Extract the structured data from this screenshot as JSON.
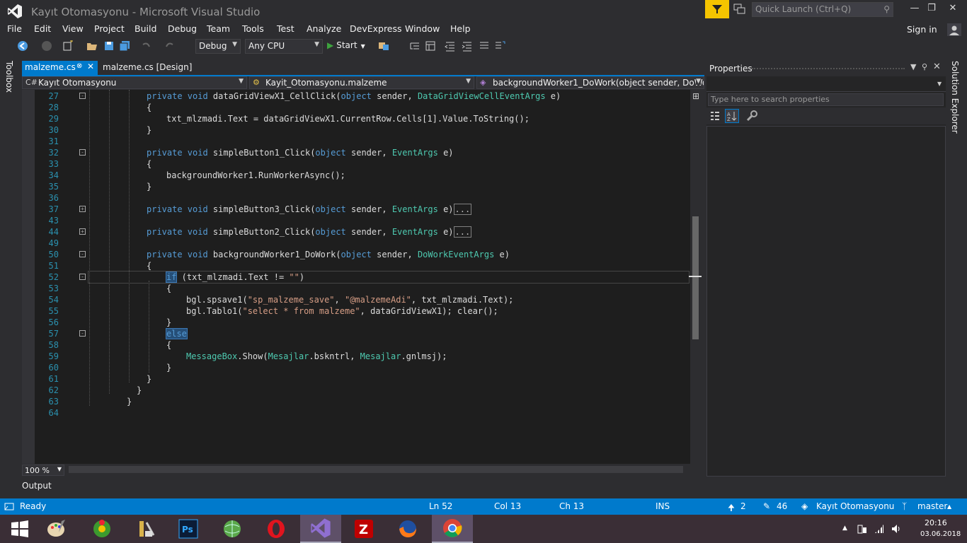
{
  "window": {
    "title": "Kayıt Otomasyonu - Microsoft Visual Studio",
    "quick_launch_placeholder": "Quick Launch (Ctrl+Q)",
    "sign_in": "Sign in"
  },
  "menu": [
    "File",
    "Edit",
    "View",
    "Project",
    "Build",
    "Debug",
    "Team",
    "Tools",
    "Test",
    "Analyze",
    "DevExpress",
    "Window",
    "Help"
  ],
  "toolbar": {
    "config": "Debug",
    "platform": "Any CPU",
    "start": "Start"
  },
  "side": {
    "toolbox": "Toolbox",
    "solution_explorer": "Solution Explorer"
  },
  "tabs": {
    "active": "malzeme.cs",
    "design": "malzeme.cs [Design]"
  },
  "nav": {
    "project": "Kayıt Otomasyonu",
    "class": "Kayit_Otomasyonu.malzeme",
    "member": "backgroundWorker1_DoWork(object sender, DoWork"
  },
  "code_lines": [
    {
      "n": "27",
      "fold": "-",
      "indent": 1,
      "tokens": [
        [
          "kw",
          "private void "
        ],
        [
          "",
          "dataGridViewX1_CellClick("
        ],
        [
          "kw",
          "object"
        ],
        [
          "",
          " sender, "
        ],
        [
          "ty",
          "DataGridViewCellEventArgs"
        ],
        [
          "",
          " e)"
        ]
      ]
    },
    {
      "n": "28",
      "fold": "",
      "indent": 1,
      "tokens": [
        [
          "",
          "{"
        ]
      ]
    },
    {
      "n": "29",
      "fold": "",
      "indent": 2,
      "tokens": [
        [
          "",
          "txt_mlzmadi.Text = dataGridViewX1.CurrentRow.Cells[1].Value.ToString();"
        ]
      ]
    },
    {
      "n": "30",
      "fold": "",
      "indent": 1,
      "tokens": [
        [
          "",
          "}"
        ]
      ]
    },
    {
      "n": "31",
      "fold": "",
      "indent": 0,
      "tokens": []
    },
    {
      "n": "32",
      "fold": "-",
      "indent": 1,
      "tokens": [
        [
          "kw",
          "private void "
        ],
        [
          "",
          "simpleButton1_Click("
        ],
        [
          "kw",
          "object"
        ],
        [
          "",
          " sender, "
        ],
        [
          "ty",
          "EventArgs"
        ],
        [
          "",
          " e)"
        ]
      ]
    },
    {
      "n": "33",
      "fold": "",
      "indent": 1,
      "tokens": [
        [
          "",
          "{"
        ]
      ]
    },
    {
      "n": "34",
      "fold": "",
      "indent": 2,
      "tokens": [
        [
          "",
          "backgroundWorker1.RunWorkerAsync();"
        ]
      ]
    },
    {
      "n": "35",
      "fold": "",
      "indent": 1,
      "tokens": [
        [
          "",
          "}"
        ]
      ]
    },
    {
      "n": "36",
      "fold": "",
      "indent": 0,
      "tokens": []
    },
    {
      "n": "37",
      "fold": "+",
      "indent": 1,
      "tokens": [
        [
          "kw",
          "private void "
        ],
        [
          "",
          "simpleButton3_Click("
        ],
        [
          "kw",
          "object"
        ],
        [
          "",
          " sender, "
        ],
        [
          "ty",
          "EventArgs"
        ],
        [
          "",
          " e)"
        ],
        [
          "collapsed",
          "..."
        ]
      ]
    },
    {
      "n": "43",
      "fold": "",
      "indent": 0,
      "tokens": []
    },
    {
      "n": "44",
      "fold": "+",
      "indent": 1,
      "tokens": [
        [
          "kw",
          "private void "
        ],
        [
          "",
          "simpleButton2_Click("
        ],
        [
          "kw",
          "object"
        ],
        [
          "",
          " sender, "
        ],
        [
          "ty",
          "EventArgs"
        ],
        [
          "",
          " e)"
        ],
        [
          "collapsed",
          "..."
        ]
      ]
    },
    {
      "n": "49",
      "fold": "",
      "indent": 0,
      "tokens": []
    },
    {
      "n": "50",
      "fold": "-",
      "indent": 1,
      "tokens": [
        [
          "kw",
          "private void "
        ],
        [
          "",
          "backgroundWorker1_DoWork("
        ],
        [
          "kw",
          "object"
        ],
        [
          "",
          " sender, "
        ],
        [
          "ty",
          "DoWorkEventArgs"
        ],
        [
          "",
          " e)"
        ]
      ]
    },
    {
      "n": "51",
      "fold": "",
      "indent": 1,
      "tokens": [
        [
          "",
          "{"
        ]
      ]
    },
    {
      "n": "52",
      "fold": "-",
      "indent": 2,
      "tokens": [
        [
          "hl-kw",
          "if"
        ],
        [
          "",
          " (txt_mlzmadi.Text != "
        ],
        [
          "st",
          "\"\""
        ],
        [
          "",
          ")"
        ]
      ]
    },
    {
      "n": "53",
      "fold": "",
      "indent": 2,
      "tokens": [
        [
          "",
          "{"
        ]
      ]
    },
    {
      "n": "54",
      "fold": "",
      "indent": 3,
      "tokens": [
        [
          "",
          "bgl.spsave1("
        ],
        [
          "st",
          "\"sp_malzeme_save\""
        ],
        [
          "",
          ", "
        ],
        [
          "st",
          "\"@malzemeAdi\""
        ],
        [
          "",
          ", txt_mlzmadi.Text);"
        ]
      ]
    },
    {
      "n": "55",
      "fold": "",
      "indent": 3,
      "tokens": [
        [
          "",
          "bgl.Tablo1("
        ],
        [
          "st",
          "\"select * from malzeme\""
        ],
        [
          "",
          ", dataGridViewX1); clear();"
        ]
      ]
    },
    {
      "n": "56",
      "fold": "",
      "indent": 2,
      "tokens": [
        [
          "",
          "}"
        ]
      ]
    },
    {
      "n": "57",
      "fold": "-",
      "indent": 2,
      "tokens": [
        [
          "hl-kw",
          "else"
        ]
      ]
    },
    {
      "n": "58",
      "fold": "",
      "indent": 2,
      "tokens": [
        [
          "",
          "{"
        ]
      ]
    },
    {
      "n": "59",
      "fold": "",
      "indent": 3,
      "tokens": [
        [
          "ty",
          "MessageBox"
        ],
        [
          "",
          ".Show("
        ],
        [
          "ty",
          "Mesajlar"
        ],
        [
          "",
          ".bskntrl, "
        ],
        [
          "ty",
          "Mesajlar"
        ],
        [
          "",
          ".gnlmsj);"
        ]
      ]
    },
    {
      "n": "60",
      "fold": "",
      "indent": 2,
      "tokens": [
        [
          "",
          "}"
        ]
      ]
    },
    {
      "n": "61",
      "fold": "",
      "indent": 1,
      "tokens": [
        [
          "",
          "}"
        ]
      ]
    },
    {
      "n": "62",
      "fold": "",
      "indent": 0.5,
      "tokens": [
        [
          "",
          "}"
        ]
      ]
    },
    {
      "n": "63",
      "fold": "",
      "indent": 0,
      "tokens": [
        [
          "",
          "}"
        ]
      ]
    },
    {
      "n": "64",
      "fold": "",
      "indent": 0,
      "tokens": []
    }
  ],
  "editor": {
    "zoom": "100 %"
  },
  "output_label": "Output",
  "properties": {
    "title": "Properties",
    "search_placeholder": "Type here to search properties"
  },
  "status": {
    "ready": "Ready",
    "ln": "Ln 52",
    "col": "Col 13",
    "ch": "Ch 13",
    "ins": "INS",
    "up_count": "2",
    "edit_count": "46",
    "repo": "Kayıt Otomasyonu",
    "branch": "master"
  },
  "clock": {
    "time": "20:16",
    "date": "03.06.2018"
  },
  "colors": {
    "accent": "#007acc",
    "editor_bg": "#1e1e1e",
    "keyword": "#569cd6",
    "type": "#4ec9b0",
    "string": "#d69d85"
  }
}
